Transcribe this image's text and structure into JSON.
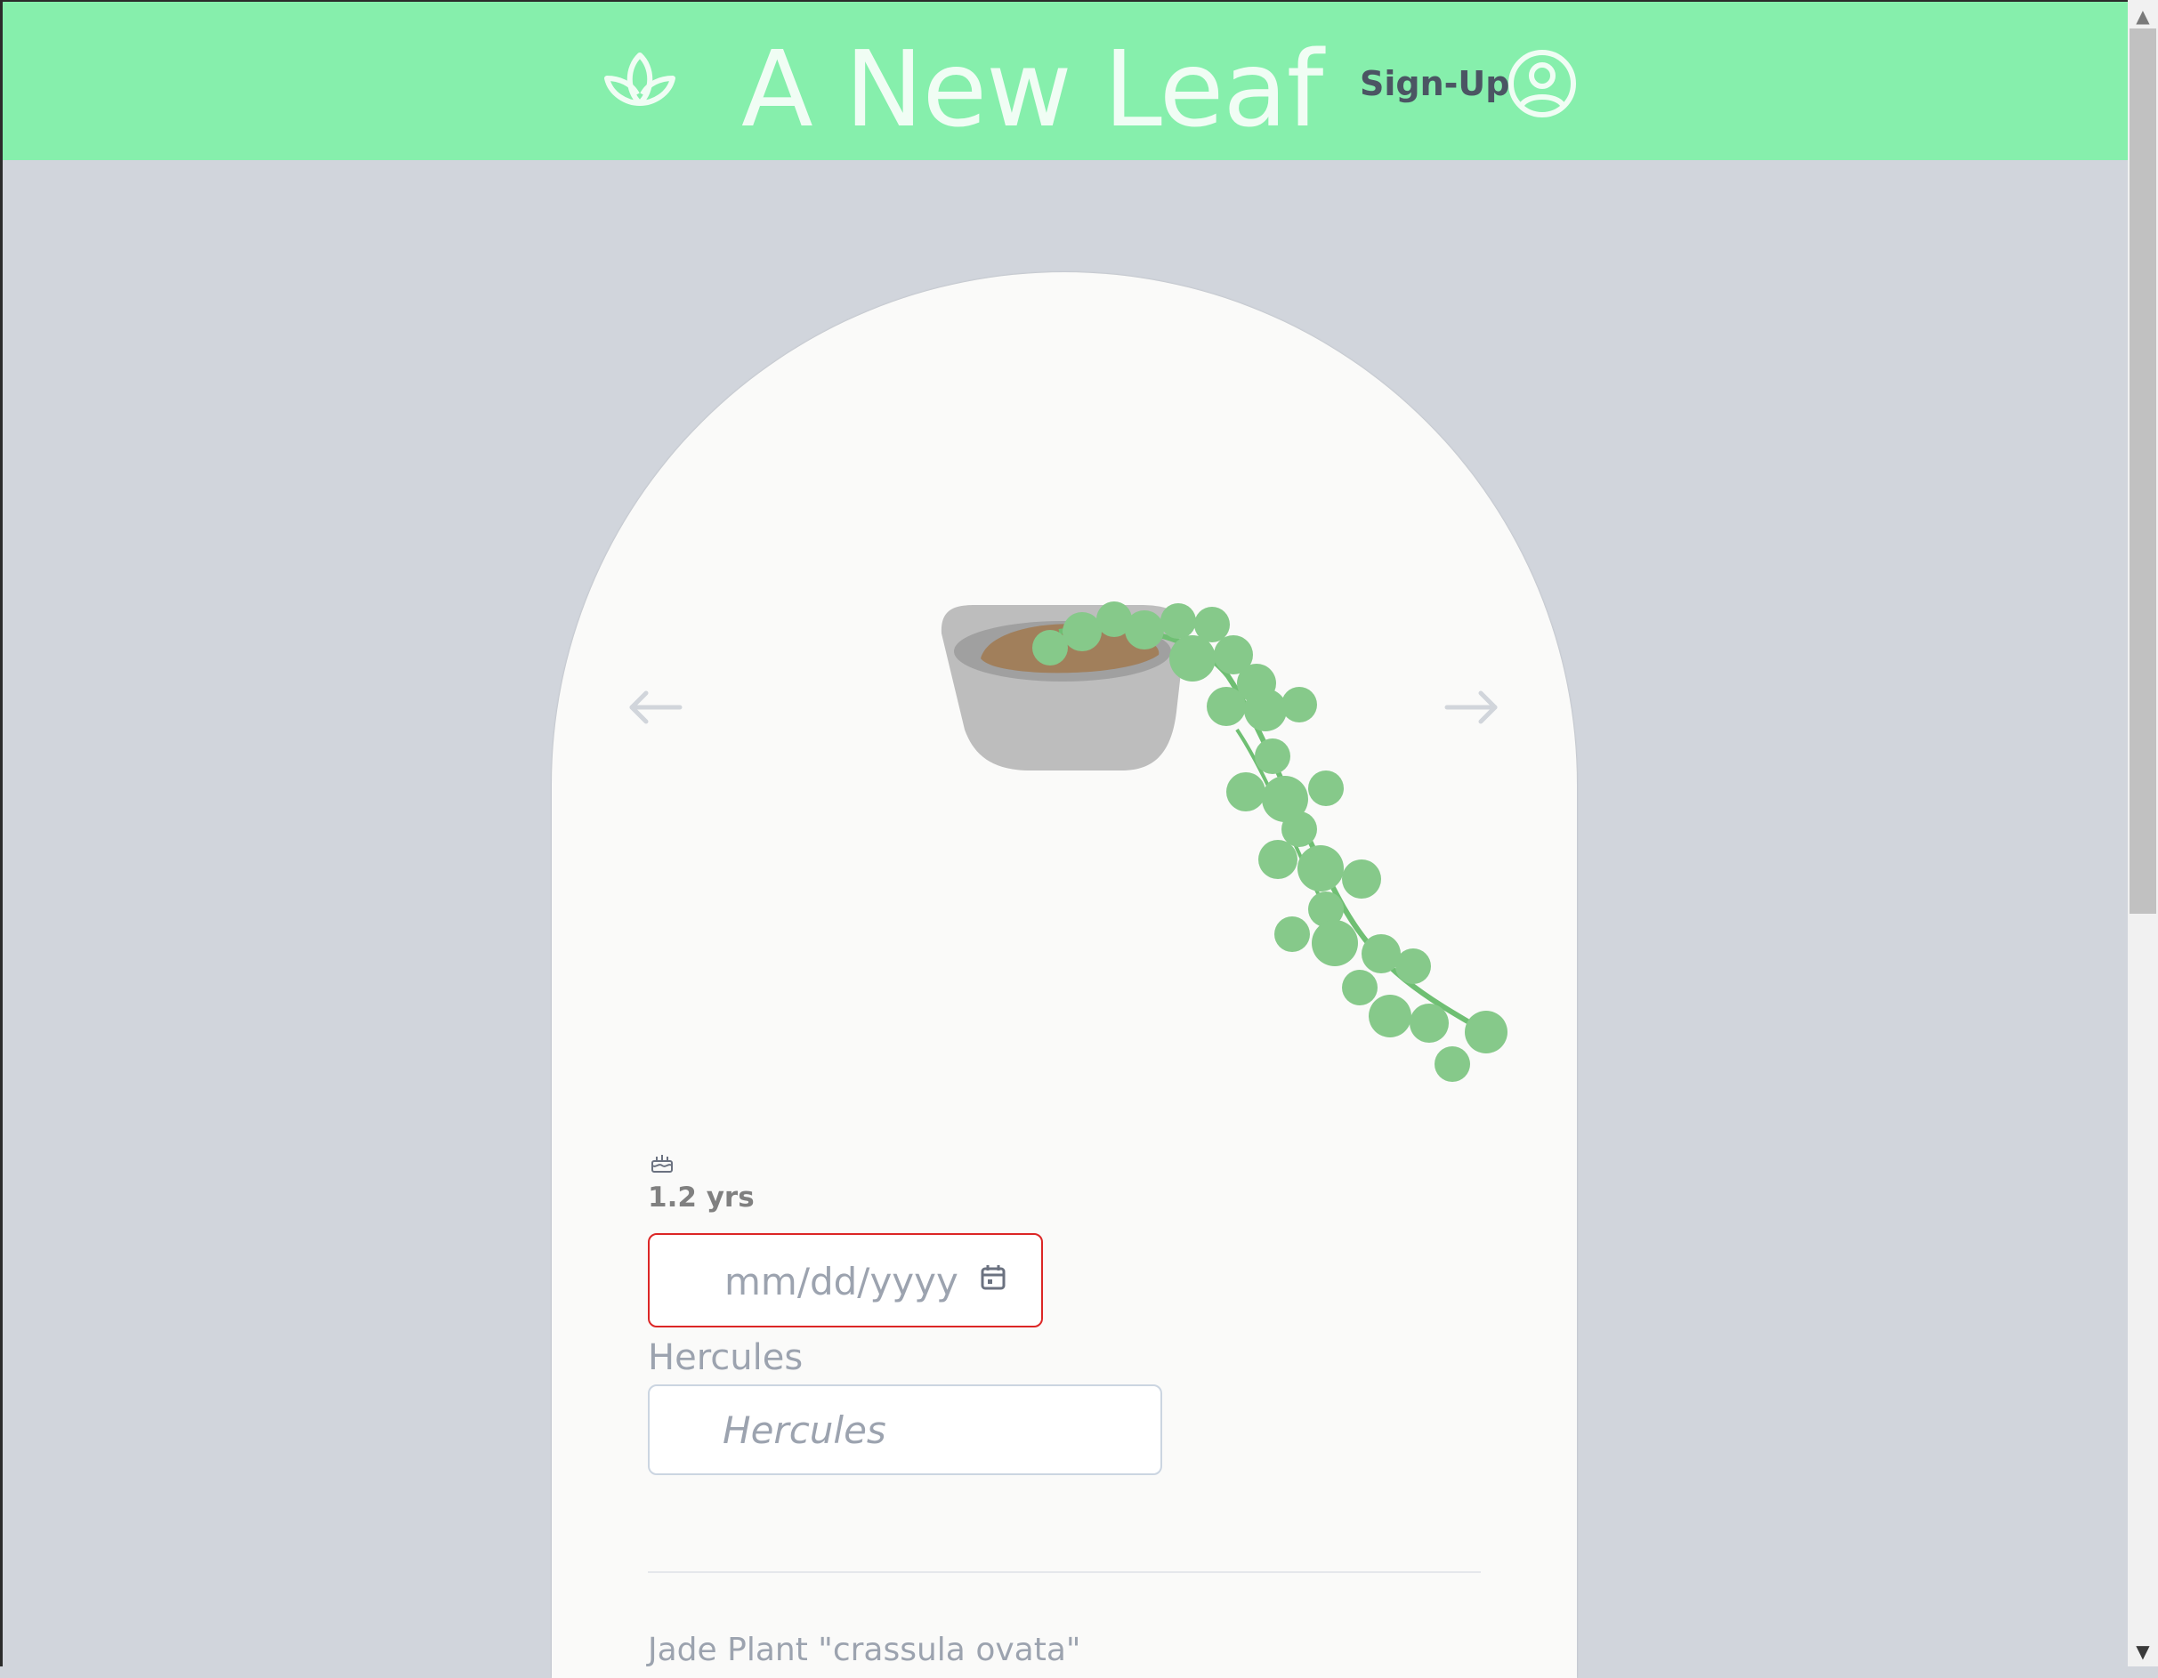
{
  "header": {
    "title": "A New Leaf",
    "signup_label": "Sign-Up",
    "logo_icon": "lotus-leaf-icon",
    "account_icon": "user-circle-icon",
    "background_color": "#86efac"
  },
  "carousel": {
    "prev_icon": "arrow-left-icon",
    "next_icon": "arrow-right-icon",
    "image": "string-of-pearls-plant-in-pot"
  },
  "plant": {
    "birthday_icon": "cake-icon",
    "age": "1.2 yrs",
    "date_placeholder": "mm/dd/yyyy",
    "date_icon": "calendar-icon",
    "name_label": "Hercules",
    "name_placeholder": "Hercules",
    "species": "Jade Plant \"crassula ovata\""
  },
  "colors": {
    "page_background": "#d1d5dc",
    "card_background": "#fafaf9",
    "date_border_error": "#dc2626"
  }
}
